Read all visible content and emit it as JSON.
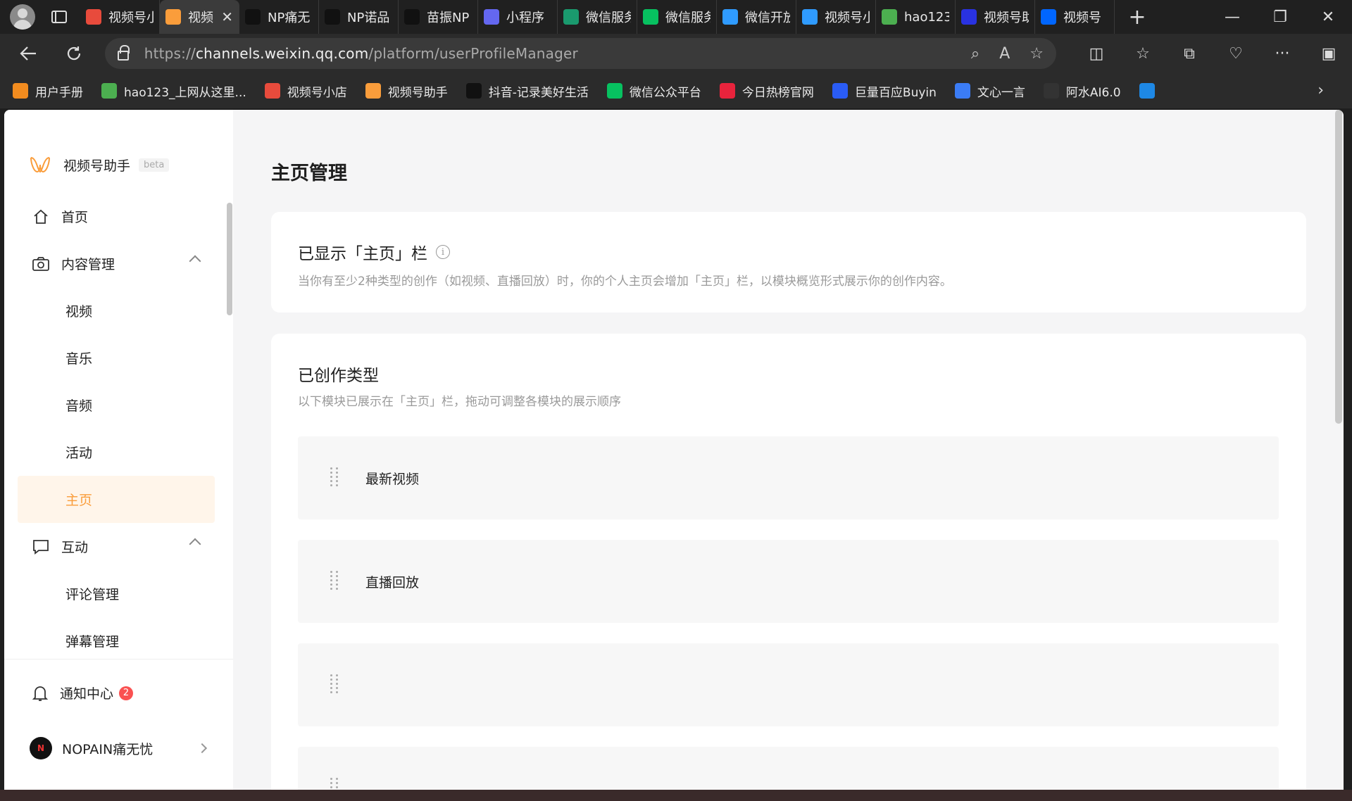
{
  "browser": {
    "tabs": [
      {
        "label": "视频号小",
        "icon": "mall-icon",
        "color": "#e84b3c"
      },
      {
        "label": "视频",
        "icon": "channels-assistant-icon",
        "color": "#fa9d3b",
        "active": true
      },
      {
        "label": "NP痛无",
        "icon": "tiktok-icon",
        "color": "#111111"
      },
      {
        "label": "NP诺品",
        "icon": "tiktok-icon",
        "color": "#111111"
      },
      {
        "label": "苗振NP",
        "icon": "tiktok-icon",
        "color": "#111111"
      },
      {
        "label": "小程序",
        "icon": "miniprogram-icon",
        "color": "#6467f0"
      },
      {
        "label": "微信服务",
        "icon": "wechat-service-icon",
        "color": "#1a9a6e"
      },
      {
        "label": "微信服务",
        "icon": "wechat-icon",
        "color": "#07c160"
      },
      {
        "label": "微信开放",
        "icon": "grid-icon",
        "color": "#2f9bff"
      },
      {
        "label": "视频号小",
        "icon": "grid-icon",
        "color": "#2f9bff"
      },
      {
        "label": "hao123",
        "icon": "hao123-icon",
        "color": "#4caf50"
      },
      {
        "label": "视频号助",
        "icon": "baidu-icon",
        "color": "#2932e1"
      },
      {
        "label": "视频号",
        "icon": "zhihu-icon",
        "color": "#0066ff"
      }
    ],
    "active_tab_close": "✕",
    "new_tab": "+",
    "window": {
      "minimize": "—",
      "restore": "❐",
      "close": "✕"
    },
    "url_prefix": "https://",
    "url_host": "channels.weixin.qq.com",
    "url_path": "/platform/userProfileManager",
    "bookmarks": [
      {
        "label": "用户手册",
        "icon": "manual-icon",
        "color": "#f28c1f"
      },
      {
        "label": "hao123_上网从这里...",
        "icon": "hao123-icon",
        "color": "#4caf50"
      },
      {
        "label": "视频号小店",
        "icon": "mall-icon",
        "color": "#e84b3c"
      },
      {
        "label": "视频号助手",
        "icon": "channels-assistant-icon",
        "color": "#fa9d3b"
      },
      {
        "label": "抖音-记录美好生活",
        "icon": "tiktok-icon",
        "color": "#111111"
      },
      {
        "label": "微信公众平台",
        "icon": "wechat-icon",
        "color": "#07c160"
      },
      {
        "label": "今日热榜官网",
        "icon": "r-icon",
        "color": "#e8233c"
      },
      {
        "label": "巨量百应Buyin",
        "icon": "b-icon",
        "color": "#2a5cf5"
      },
      {
        "label": "文心一言",
        "icon": "wenxin-icon",
        "color": "#3b7cf5"
      },
      {
        "label": "阿水AI6.0",
        "icon": "ai-icon",
        "color": "#333333"
      },
      {
        "label": "",
        "icon": "s-icon",
        "color": "#1e88e5"
      }
    ]
  },
  "sidebar": {
    "brand_name": "视频号助手",
    "beta": "beta",
    "menu": [
      {
        "label": "首页",
        "icon": "home-icon",
        "type": "item"
      },
      {
        "label": "内容管理",
        "icon": "camera-icon",
        "type": "group",
        "expanded": true
      },
      {
        "label": "视频",
        "type": "sub"
      },
      {
        "label": "音乐",
        "type": "sub"
      },
      {
        "label": "音频",
        "type": "sub"
      },
      {
        "label": "活动",
        "type": "sub"
      },
      {
        "label": "主页",
        "type": "sub",
        "active": true
      },
      {
        "label": "互动",
        "icon": "comment-icon",
        "type": "group",
        "expanded": true
      },
      {
        "label": "评论管理",
        "type": "sub"
      },
      {
        "label": "弹幕管理",
        "type": "sub"
      }
    ],
    "notification_label": "通知中心",
    "notification_count": "2",
    "account_name": "NOPAIN痛无忧"
  },
  "main": {
    "title": "主页管理",
    "shown_card": {
      "title": "已显示「主页」栏",
      "desc": "当你有至少2种类型的创作（如视频、直播回放）时，你的个人主页会增加「主页」栏，以模块概览形式展示你的创作内容。"
    },
    "types_card": {
      "title": "已创作类型",
      "desc": "以下模块已展示在「主页」栏，拖动可调整各模块的展示顺序",
      "modules": [
        "最新视频",
        "直播回放",
        "",
        ""
      ]
    }
  },
  "colors": {
    "accent": "#fa9d3b",
    "active_bg": "#fff5ea",
    "badge": "#fa5151",
    "page_bg": "#f5f5f6"
  }
}
